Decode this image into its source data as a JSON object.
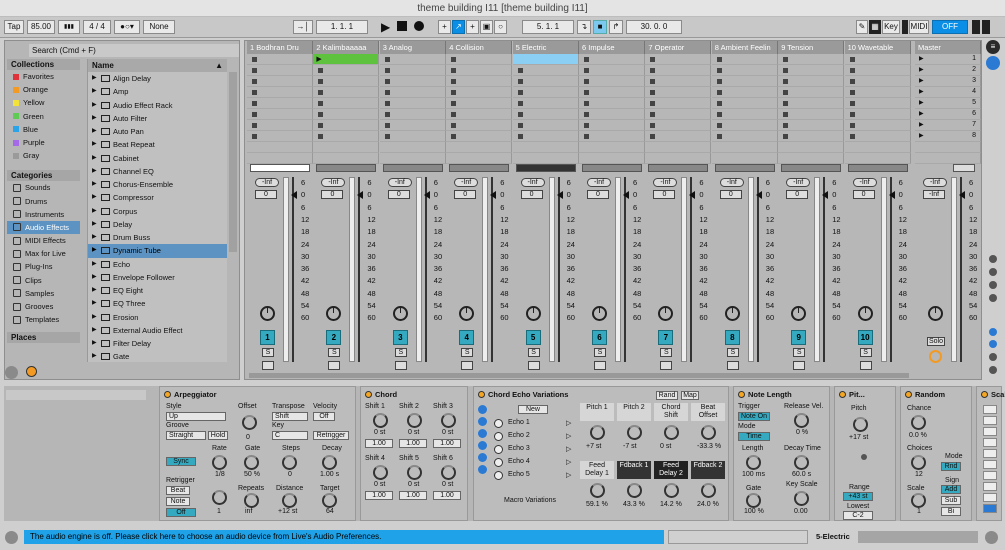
{
  "window": {
    "title": "theme building I11  [theme building I11]"
  },
  "transport": {
    "tap": "Tap",
    "tempo": "85.00",
    "signature": "4 / 4",
    "quantize": "None",
    "arrangement_pos": "1.   1.   1",
    "loop_start": "5.   1.   1",
    "loop_length": "30.   0.   0",
    "key": "Key",
    "midi": "MIDI",
    "cpu": "OFF"
  },
  "browser": {
    "search_placeholder": "Search (Cmd + F)",
    "collections_header": "Collections",
    "collections": [
      {
        "label": "Favorites",
        "color": "#e0323b"
      },
      {
        "label": "Orange",
        "color": "#f39a25"
      },
      {
        "label": "Yellow",
        "color": "#f2e23a"
      },
      {
        "label": "Green",
        "color": "#5ecb52"
      },
      {
        "label": "Blue",
        "color": "#2ba3e8"
      },
      {
        "label": "Purple",
        "color": "#a56ae8"
      },
      {
        "label": "Gray",
        "color": "#9a9a9a"
      }
    ],
    "categories_header": "Categories",
    "categories": [
      {
        "label": "Sounds"
      },
      {
        "label": "Drums"
      },
      {
        "label": "Instruments"
      },
      {
        "label": "Audio Effects"
      },
      {
        "label": "MIDI Effects"
      },
      {
        "label": "Max for Live"
      },
      {
        "label": "Plug-Ins"
      },
      {
        "label": "Clips"
      },
      {
        "label": "Samples"
      },
      {
        "label": "Grooves"
      },
      {
        "label": "Templates"
      }
    ],
    "places_header": "Places",
    "name_header": "Name",
    "items": [
      "Align Delay",
      "Amp",
      "Audio Effect Rack",
      "Auto Filter",
      "Auto Pan",
      "Beat Repeat",
      "Cabinet",
      "Channel EQ",
      "Chorus-Ensemble",
      "Compressor",
      "Corpus",
      "Delay",
      "Drum Buss",
      "Dynamic Tube",
      "Echo",
      "Envelope Follower",
      "EQ Eight",
      "EQ Three",
      "Erosion",
      "External Audio Effect",
      "Filter Delay",
      "Gate"
    ]
  },
  "session": {
    "tracks": [
      {
        "name": "1 Bodhran Dru",
        "num": "1"
      },
      {
        "name": "2 Kalimbaaaaa",
        "num": "2"
      },
      {
        "name": "3 Analog",
        "num": "3"
      },
      {
        "name": "4 Collision",
        "num": "4"
      },
      {
        "name": "5 Electric",
        "num": "5"
      },
      {
        "name": "6 Impulse",
        "num": "6"
      },
      {
        "name": "7 Operator",
        "num": "7"
      },
      {
        "name": "8 Ambient Feelin",
        "num": "8"
      },
      {
        "name": "9 Tension",
        "num": "9"
      },
      {
        "name": "10 Wavetable",
        "num": "10"
      }
    ],
    "master": "Master",
    "scene_numbers": [
      "1",
      "2",
      "3",
      "4",
      "5",
      "6",
      "7",
      "8"
    ],
    "inf": "-Inf",
    "zero": "0",
    "solo_label": "S",
    "solo": "Solo",
    "scale": [
      "6",
      "0",
      "6",
      "12",
      "18",
      "24",
      "30",
      "36",
      "42",
      "48",
      "54",
      "60"
    ]
  },
  "devices": {
    "arp": {
      "title": "Arpeggiator",
      "style_l": "Style",
      "style": "Up",
      "groove_l": "Groove",
      "groove": "Straight",
      "hold": "Hold",
      "offset_l": "Offset",
      "offset": "0",
      "transpose_l": "Transpose",
      "transpose": "Shift",
      "key_l": "Key",
      "key": "C",
      "velocity_l": "Velocity",
      "velocity": "Off",
      "retrigger_b": "Retrigger",
      "sync": "Sync",
      "rate_l": "Rate",
      "rate": "1/8",
      "gate_l": "Gate",
      "gate": "50 %",
      "steps_l": "Steps",
      "steps": "0",
      "decay_l": "Decay",
      "decay": "1.00 s",
      "retrigger_l": "Retrigger",
      "beat": "Beat",
      "note": "Note",
      "off": "Off",
      "r1": "1",
      "repeats_l": "Repeats",
      "repeats": "inf",
      "distance_l": "Distance",
      "distance": "+12 st",
      "target_l": "Target",
      "target": "64"
    },
    "chord": {
      "title": "Chord",
      "shifts": [
        {
          "l": "Shift 1",
          "v": "0 st",
          "g": "1.00"
        },
        {
          "l": "Shift 2",
          "v": "0 st",
          "g": "1.00"
        },
        {
          "l": "Shift 3",
          "v": "0 st",
          "g": "1.00"
        },
        {
          "l": "Shift 4",
          "v": "0 st",
          "g": "1.00"
        },
        {
          "l": "Shift 5",
          "v": "0 st",
          "g": "1.00"
        },
        {
          "l": "Shift 6",
          "v": "0 st",
          "g": "1.00"
        }
      ]
    },
    "echo": {
      "title": "Chord Echo Variations",
      "rand": "Rand",
      "map": "Map",
      "new": "New",
      "variations": [
        "Echo 1",
        "Echo 2",
        "Echo 3",
        "Echo 4",
        "Echo 5"
      ],
      "macro": "Macro Variations",
      "macros": [
        {
          "l": "Pitch 1",
          "v": "+7 st"
        },
        {
          "l": "Pitch 2",
          "v": "-7 st"
        },
        {
          "l": "Chord Shift",
          "v": "0 st"
        },
        {
          "l": "Beat Offset",
          "v": "-33.3 %"
        },
        {
          "l": "Feed Delay 1",
          "v": "59.1 %"
        },
        {
          "l": "Fdback 1",
          "v": "43.3 %"
        },
        {
          "l": "Feed Delay 2",
          "v": "14.2 %"
        },
        {
          "l": "Fdback 2",
          "v": "24.0 %"
        }
      ]
    },
    "notelength": {
      "title": "Note Length",
      "trigger_l": "Trigger",
      "trigger": "Note On",
      "mode_l": "Mode",
      "mode": "Time",
      "length_l": "Length",
      "length": "100 ms",
      "gate_l": "Gate",
      "gate": "100 %",
      "release_l": "Release Vel.",
      "release": "0 %",
      "decay_l": "Decay Time",
      "decay": "60.0 s",
      "keyscale_l": "Key Scale",
      "keyscale": "0.00"
    },
    "pitch": {
      "title": "Pit...",
      "pitch_l": "Pitch",
      "pitch": "+17 st",
      "range_l": "Range",
      "range": "+43 st",
      "lowest_l": "Lowest",
      "lowest": "C-2"
    },
    "random": {
      "title": "Random",
      "chance_l": "Chance",
      "chance": "0.0 %",
      "choices_l": "Choices",
      "choices": "12",
      "mode_l": "Mode",
      "mode": "Rnd",
      "scale_l": "Scale",
      "scale": "1",
      "sign_l": "Sign",
      "add": "Add",
      "sub": "Sub",
      "bi": "Bi"
    },
    "scale": {
      "title": "Scal"
    }
  },
  "status": {
    "message": "The audio engine is off. Please click here to choose an audio device from Live's Audio Preferences.",
    "track": "5-Electric"
  }
}
